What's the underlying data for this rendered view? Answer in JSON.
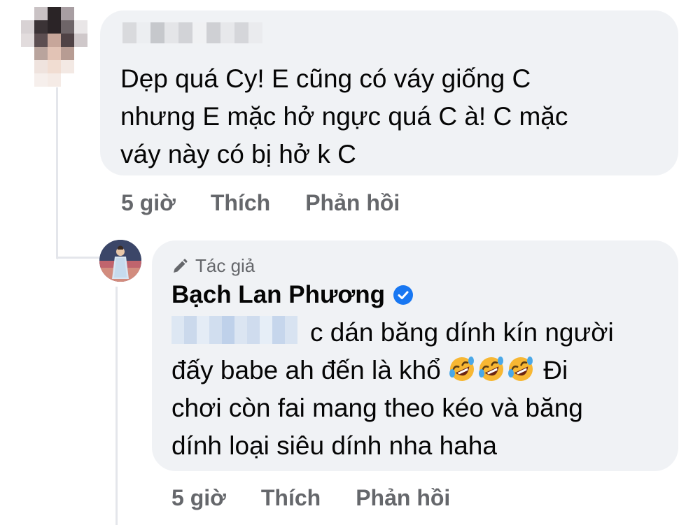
{
  "comment": {
    "text_line1": "Dẹp quá Cy! E cũng có váy giống C",
    "text_line2": "nhưng E mặc hở ngực quá C à! C mặc",
    "text_line3": "váy này có bị hở k C",
    "time": "5 giờ",
    "like_label": "Thích",
    "reply_label": "Phản hồi"
  },
  "reply": {
    "author_tag": "Tác giả",
    "author_name": "Bạch Lan Phương",
    "text_line1": "c dán băng dính kín người",
    "text_line2": "đấy babe ah đến là khổ",
    "text_line2b": "Đi",
    "text_line3": "chơi còn fai mang theo kéo và băng",
    "text_line4": "dính loại siêu dính nha haha",
    "emoji_name": "rolling-on-floor-laughing",
    "time": "5 giờ",
    "like_label": "Thích",
    "reply_label": "Phản hồi"
  },
  "colors": {
    "bubble": "#f0f2f5",
    "secondary_text": "#65676b",
    "verified": "#1877f2"
  }
}
